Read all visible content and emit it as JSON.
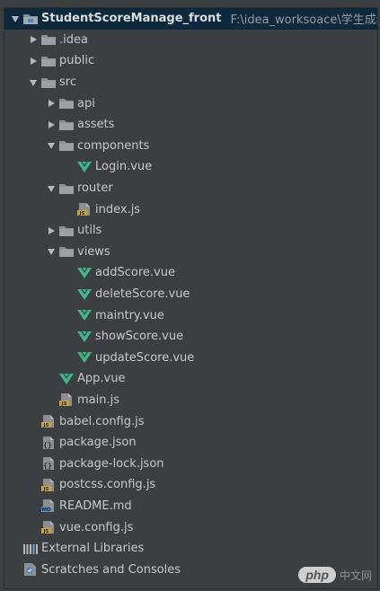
{
  "tree": {
    "root": {
      "label": "StudentScoreManage_front",
      "path": "F:\\idea_worksoace\\学生成绩"
    },
    "items": [
      {
        "label": "StudentScoreManage_front",
        "depth": 0,
        "type": "project",
        "expanded": true
      },
      {
        "label": ".idea",
        "depth": 1,
        "type": "folder",
        "expanded": false
      },
      {
        "label": "public",
        "depth": 1,
        "type": "folder",
        "expanded": false
      },
      {
        "label": "src",
        "depth": 1,
        "type": "folder",
        "expanded": true
      },
      {
        "label": "api",
        "depth": 2,
        "type": "folder",
        "expanded": false
      },
      {
        "label": "assets",
        "depth": 2,
        "type": "folder",
        "expanded": false
      },
      {
        "label": "components",
        "depth": 2,
        "type": "folder",
        "expanded": true
      },
      {
        "label": "Login.vue",
        "depth": 3,
        "type": "vue"
      },
      {
        "label": "router",
        "depth": 2,
        "type": "folder",
        "expanded": true
      },
      {
        "label": "index.js",
        "depth": 3,
        "type": "js"
      },
      {
        "label": "utils",
        "depth": 2,
        "type": "folder",
        "expanded": false
      },
      {
        "label": "views",
        "depth": 2,
        "type": "folder",
        "expanded": true
      },
      {
        "label": "addScore.vue",
        "depth": 3,
        "type": "vue"
      },
      {
        "label": "deleteScore.vue",
        "depth": 3,
        "type": "vue"
      },
      {
        "label": "maintry.vue",
        "depth": 3,
        "type": "vue"
      },
      {
        "label": "showScore.vue",
        "depth": 3,
        "type": "vue"
      },
      {
        "label": "updateScore.vue",
        "depth": 3,
        "type": "vue"
      },
      {
        "label": "App.vue",
        "depth": 2,
        "type": "vue"
      },
      {
        "label": "main.js",
        "depth": 2,
        "type": "js"
      },
      {
        "label": "babel.config.js",
        "depth": 1,
        "type": "js"
      },
      {
        "label": "package.json",
        "depth": 1,
        "type": "json"
      },
      {
        "label": "package-lock.json",
        "depth": 1,
        "type": "json"
      },
      {
        "label": "postcss.config.js",
        "depth": 1,
        "type": "js"
      },
      {
        "label": "README.md",
        "depth": 1,
        "type": "md"
      },
      {
        "label": "vue.config.js",
        "depth": 1,
        "type": "js"
      },
      {
        "label": "External Libraries",
        "depth": 0,
        "type": "libraries"
      },
      {
        "label": "Scratches and Consoles",
        "depth": 0,
        "type": "scratches"
      }
    ]
  },
  "watermark": {
    "badge": "php",
    "text": "中文网"
  },
  "colors": {
    "background": "#3c3f41",
    "selection": "#0d293e",
    "folder": "#8a8f93",
    "vue": "#41b883",
    "js": "#c9a23a"
  }
}
